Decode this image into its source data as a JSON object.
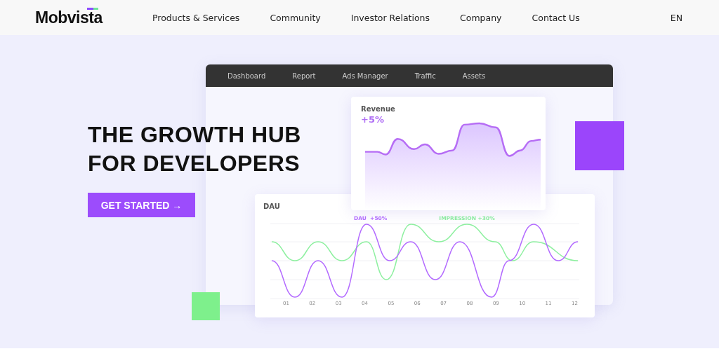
{
  "header": {
    "logo": "Mobvista",
    "nav": [
      {
        "label": "Products & Services"
      },
      {
        "label": "Community"
      },
      {
        "label": "Investor Relations"
      },
      {
        "label": "Company"
      },
      {
        "label": "Contact Us"
      }
    ],
    "language": "EN"
  },
  "hero": {
    "headline": [
      "THE GROWTH HUB",
      "FOR DEVELOPERS"
    ],
    "cta": "GET STARTED →"
  },
  "dashboard": {
    "tabs": [
      {
        "label": "Dashboard"
      },
      {
        "label": "Report"
      },
      {
        "label": "Ads Manager"
      },
      {
        "label": "Traffic"
      },
      {
        "label": "Assets"
      }
    ],
    "revenue_card": {
      "title": "Revenue",
      "change": "+5%"
    },
    "dau_card": {
      "title": "DAU",
      "legend": [
        {
          "label": "DAU  +50%",
          "color": "#b36bff"
        },
        {
          "label": "IMPRESSION +30%",
          "color": "#8ef0a0"
        }
      ],
      "x_labels": [
        "01",
        "02",
        "03",
        "04",
        "05",
        "06",
        "07",
        "08",
        "09",
        "10",
        "11",
        "12"
      ]
    }
  }
}
